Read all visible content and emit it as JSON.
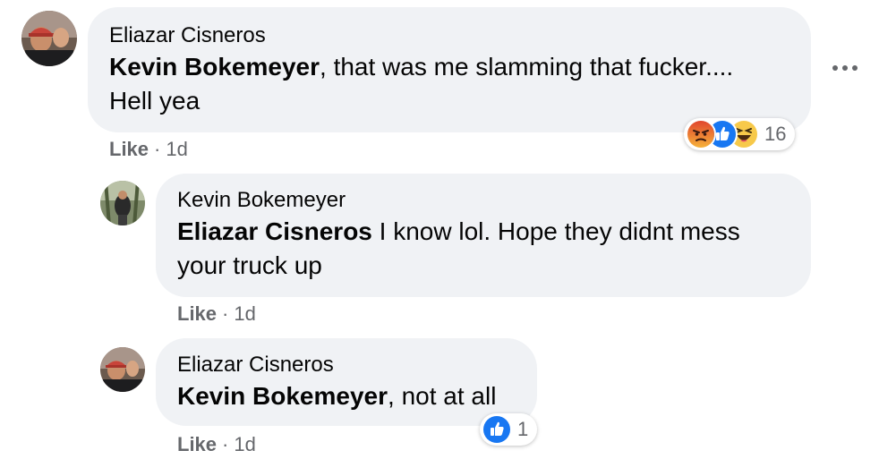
{
  "colors": {
    "bubble_bg": "#f0f2f5",
    "meta_text": "#65676b",
    "like_blue": "#1877f2",
    "angry_orange": "#f26b2b",
    "haha_yellow": "#f7c94a"
  },
  "comments": [
    {
      "author": "Eliazar Cisneros",
      "mention": "Kevin Bokemeyer",
      "text_line1_rest": ", that was me slamming that fucker....",
      "text_line2": "Hell yea",
      "like_label": "Like",
      "separator": "·",
      "time": "1d",
      "reactions": {
        "icons": [
          "angry-icon",
          "like-icon",
          "haha-icon"
        ],
        "count": "16"
      }
    },
    {
      "author": "Kevin Bokemeyer",
      "mention": "Eliazar Cisneros",
      "text_line1_rest": " I know lol. Hope they didnt mess",
      "text_line2": "your truck up",
      "like_label": "Like",
      "separator": "·",
      "time": "1d"
    },
    {
      "author": "Eliazar Cisneros",
      "mention": "Kevin Bokemeyer",
      "text_line1_rest": ", not at all",
      "like_label": "Like",
      "separator": "·",
      "time": "1d",
      "reactions": {
        "icons": [
          "like-icon"
        ],
        "count": "1"
      }
    }
  ],
  "more_icon": "more-options-icon"
}
